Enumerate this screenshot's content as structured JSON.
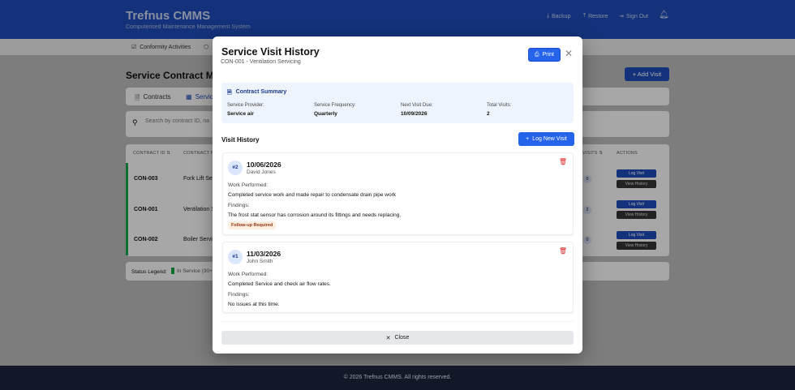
{
  "app": {
    "title": "Trefnus CMMS",
    "subtitle": "Computerised Maintenance Management System",
    "actions": [
      {
        "label": "Backup",
        "icon": "download-icon"
      },
      {
        "label": "Restore",
        "icon": "upload-icon"
      },
      {
        "label": "Sign Out",
        "icon": "sign-out-icon"
      }
    ]
  },
  "nav": {
    "items": [
      {
        "label": "Conformity Activities",
        "icon": "checkbox-icon"
      }
    ]
  },
  "page": {
    "title": "Service Contract Man",
    "add_visit": "+ Add Visit",
    "tabs": [
      {
        "label": "Contracts"
      },
      {
        "label": "Servic"
      }
    ],
    "search_placeholder": "Search by contract ID, na",
    "columns": {
      "id": "CONTRACT ID ⇅",
      "name": "CONTRACT NA",
      "visits": "VISITS ⇅",
      "actions": "ACTIONS"
    },
    "rows": [
      {
        "id": "CON-003",
        "name": "Fork Lift Serv",
        "visits": "0"
      },
      {
        "id": "CON-001",
        "name": "Ventilation Se",
        "visits": "2"
      },
      {
        "id": "CON-002",
        "name": "Boiler Servici",
        "visits": "0"
      }
    ],
    "log_visit": "Log Visit",
    "view_history": "View History",
    "legend_label": "Status Legend:",
    "legend_item": "In Service (30+ d",
    "legend_color": "#16a34a"
  },
  "modal": {
    "title": "Service Visit History",
    "subtitle": "CON-001 - Ventilation Servicing",
    "print": "Print",
    "summary": {
      "heading": "Contract Summary",
      "fields": [
        {
          "label": "Service Provider:",
          "value": "Service air"
        },
        {
          "label": "Service Frequency:",
          "value": "Quarterly"
        },
        {
          "label": "Next Visit Due:",
          "value": "10/09/2026"
        },
        {
          "label": "Total Visits:",
          "value": "2"
        }
      ]
    },
    "visit_history_label": "Visit History",
    "log_new_visit": "Log New Visit",
    "work_label": "Work Performed:",
    "findings_label": "Findings:",
    "visits": [
      {
        "number": "#2",
        "date": "10/06/2026",
        "technician": "David Jones",
        "work": "Completed service work and made repair to condensate drain pipe work",
        "findings": "The frost stat sensor has corrosion around its fittings and needs replacing.",
        "badge": "Follow-up Required"
      },
      {
        "number": "#1",
        "date": "11/03/2026",
        "technician": "John Smith",
        "work": "Completed Service and check air flow rates.",
        "findings": "No issues at this time."
      }
    ],
    "close": "Close"
  },
  "footer": {
    "text": "© 2026 Trefnus CMMS. All rights reserved."
  },
  "colors": {
    "header": "#1e4bb5",
    "primary": "#2563eb",
    "danger": "#dc2626"
  }
}
